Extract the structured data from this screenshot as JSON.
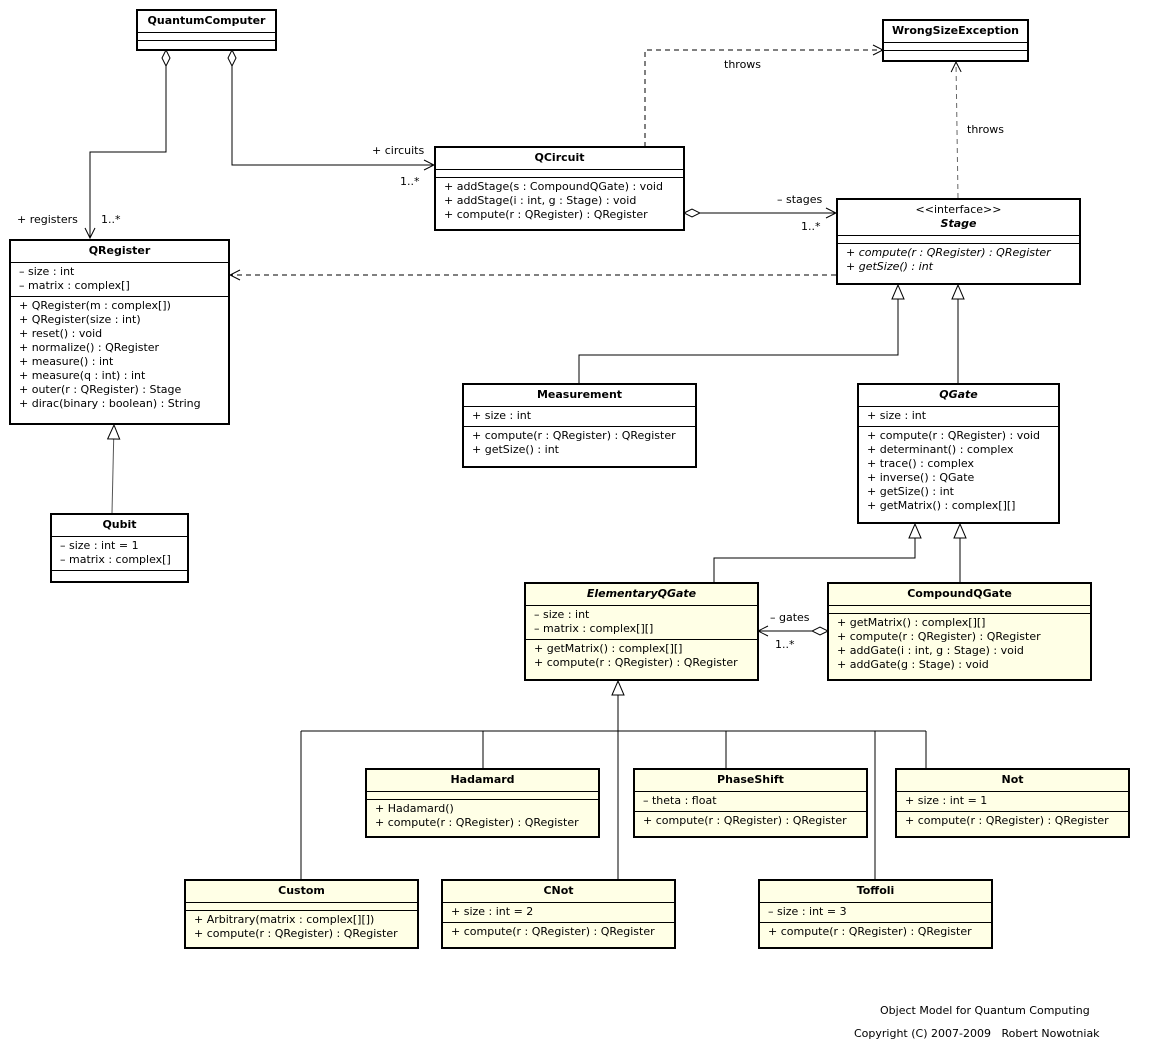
{
  "classes": {
    "quantum_computer": {
      "name": "QuantumComputer",
      "attributes": [],
      "operations": []
    },
    "wrong_size_exception": {
      "name": "WrongSizeException",
      "attributes": [],
      "operations": []
    },
    "qcircuit": {
      "name": "QCircuit",
      "attributes": [],
      "operations": [
        "+ addStage(s : CompoundQGate) : void",
        "+ addStage(i : int, g : Stage) : void",
        "+ compute(r : QRegister) : QRegister"
      ]
    },
    "stage": {
      "stereotype": "<<interface>>",
      "name": "Stage",
      "attributes": [],
      "operations": [
        "+ compute(r : QRegister) : QRegister",
        "+ getSize() : int"
      ]
    },
    "qregister": {
      "name": "QRegister",
      "attributes": [
        "– size : int",
        "– matrix : complex[]"
      ],
      "operations": [
        "+ QRegister(m : complex[])",
        "+ QRegister(size : int)",
        "+ reset() : void",
        "+ normalize() : QRegister",
        "+ measure() : int",
        "+ measure(q : int) : int",
        "+ outer(r : QRegister) : Stage",
        "+ dirac(binary : boolean) : String"
      ]
    },
    "qubit": {
      "name": "Qubit",
      "attributes": [
        "– size : int = 1",
        "– matrix : complex[]"
      ],
      "operations": []
    },
    "measurement": {
      "name": "Measurement",
      "attributes": [
        "+ size : int"
      ],
      "operations": [
        "+ compute(r : QRegister) : QRegister",
        "+ getSize() : int"
      ]
    },
    "qgate": {
      "name": "QGate",
      "attributes": [
        "+ size : int"
      ],
      "operations": [
        "+ compute(r : QRegister) : void",
        "+ determinant() : complex",
        "+ trace() : complex",
        "+ inverse() : QGate",
        "+ getSize() : int",
        "+ getMatrix() : complex[][]"
      ]
    },
    "elementary_qgate": {
      "name": "ElementaryQGate",
      "attributes": [
        "– size : int",
        "– matrix : complex[][]"
      ],
      "operations": [
        "+ getMatrix() : complex[][]",
        "+ compute(r : QRegister) : QRegister"
      ]
    },
    "compound_qgate": {
      "name": "CompoundQGate",
      "attributes": [],
      "operations": [
        "+ getMatrix() : complex[][]",
        "+ compute(r : QRegister) : QRegister",
        "+ addGate(i : int, g : Stage) : void",
        "+ addGate(g : Stage) : void"
      ]
    },
    "hadamard": {
      "name": "Hadamard",
      "attributes": [],
      "operations": [
        "+ Hadamard()",
        "+ compute(r : QRegister) : QRegister"
      ]
    },
    "phaseshift": {
      "name": "PhaseShift",
      "attributes": [
        "– theta : float"
      ],
      "operations": [
        "+ compute(r : QRegister) : QRegister"
      ]
    },
    "not": {
      "name": "Not",
      "attributes": [
        "+ size : int = 1"
      ],
      "operations": [
        "+ compute(r : QRegister) : QRegister"
      ]
    },
    "custom": {
      "name": "Custom",
      "attributes": [],
      "operations": [
        "+ Arbitrary(matrix : complex[][])",
        "+ compute(r : QRegister) : QRegister"
      ]
    },
    "cnot": {
      "name": "CNot",
      "attributes": [
        "+ size : int = 2"
      ],
      "operations": [
        "+ compute(r : QRegister) : QRegister"
      ]
    },
    "toffoli": {
      "name": "Toffoli",
      "attributes": [
        "– size : int = 3"
      ],
      "operations": [
        "+ compute(r : QRegister) : QRegister"
      ]
    }
  },
  "labels": {
    "registers_role": "+ registers",
    "registers_mult": "1..*",
    "circuits_role": "+ circuits",
    "circuits_mult": "1..*",
    "stages_role": "– stages",
    "stages_mult": "1..*",
    "gates_role": "– gates",
    "gates_mult": "1..*",
    "throws_circuit": "throws",
    "throws_stage": "throws"
  },
  "caption": {
    "title": "Object Model for Quantum Computing",
    "copyright": "Copyright (C) 2007-2009   Robert Nowotniak"
  },
  "colors": {
    "class_fill_yellow": "#ffffe6",
    "class_fill_white": "#ffffff",
    "line": "#000000"
  }
}
